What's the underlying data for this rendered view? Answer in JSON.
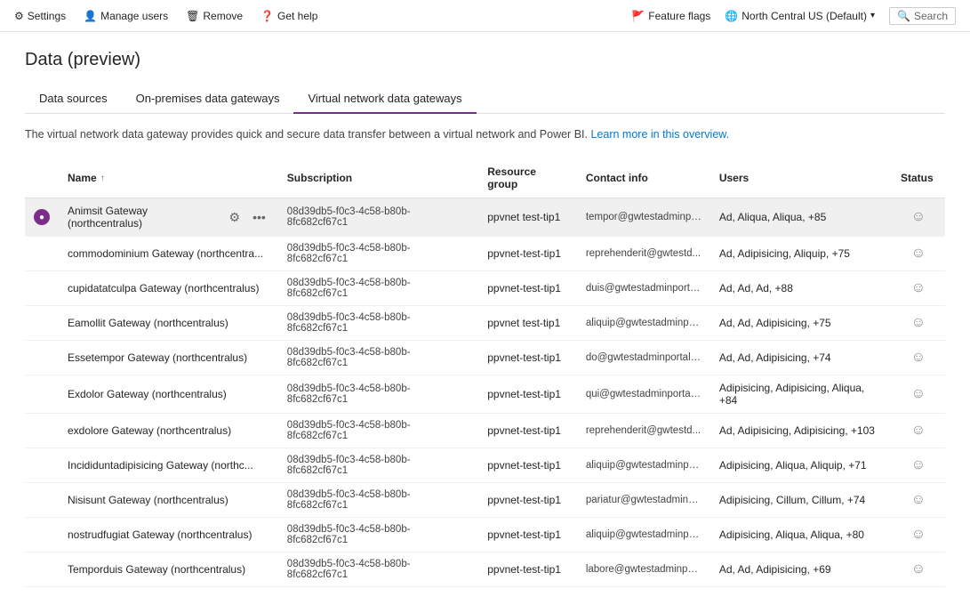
{
  "topbar": {
    "items_left": [
      {
        "id": "settings",
        "icon": "⚙",
        "label": "Settings"
      },
      {
        "id": "manage-users",
        "icon": "👤",
        "label": "Manage users"
      },
      {
        "id": "remove",
        "icon": "🗑",
        "label": "Remove"
      },
      {
        "id": "get-help",
        "icon": "❓",
        "label": "Get help"
      }
    ],
    "items_right": [
      {
        "id": "feature-flags",
        "icon": "🚩",
        "label": "Feature flags"
      },
      {
        "id": "region",
        "icon": "🌐",
        "label": "North Central US (Default)"
      },
      {
        "id": "search",
        "icon": "🔍",
        "label": "Search"
      }
    ]
  },
  "page": {
    "title": "Data (preview)"
  },
  "tabs": [
    {
      "id": "data-sources",
      "label": "Data sources",
      "active": false
    },
    {
      "id": "on-premises",
      "label": "On-premises data gateways",
      "active": false
    },
    {
      "id": "virtual-network",
      "label": "Virtual network data gateways",
      "active": true
    }
  ],
  "description": {
    "text": "The virtual network data gateway provides quick and secure data transfer between a virtual network and Power BI.",
    "link_text": "Learn more in this overview.",
    "link_url": "#"
  },
  "table": {
    "columns": [
      {
        "id": "name",
        "label": "Name",
        "sort": "↑"
      },
      {
        "id": "subscription",
        "label": "Subscription"
      },
      {
        "id": "resource-group",
        "label": "Resource group"
      },
      {
        "id": "contact-info",
        "label": "Contact info"
      },
      {
        "id": "users",
        "label": "Users"
      },
      {
        "id": "status",
        "label": "Status"
      }
    ],
    "rows": [
      {
        "id": "row-1",
        "selected": true,
        "icon": "●",
        "name": "Animsit Gateway (northcentralus)",
        "subscription": "08d39db5-f0c3-4c58-b80b-8fc682cf67c1",
        "resource_group": "ppvnet test-tip1",
        "contact_info": "tempor@gwtestadminport...",
        "users": "Ad, Aliqua, Aliqua, +85",
        "status": "😊"
      },
      {
        "id": "row-2",
        "selected": false,
        "icon": "",
        "name": "commodominium Gateway (northcentra...",
        "subscription": "08d39db5-f0c3-4c58-b80b-8fc682cf67c1",
        "resource_group": "ppvnet-test-tip1",
        "contact_info": "reprehenderit@gwtestd...",
        "users": "Ad, Adipisicing, Aliquip, +75",
        "status": "😊"
      },
      {
        "id": "row-3",
        "selected": false,
        "icon": "",
        "name": "cupidatatculpa Gateway (northcentralus)",
        "subscription": "08d39db5-f0c3-4c58-b80b-8fc682cf67c1",
        "resource_group": "ppvnet-test-tip1",
        "contact_info": "duis@gwtestadminportal...",
        "users": "Ad, Ad, Ad, +88",
        "status": "😊"
      },
      {
        "id": "row-4",
        "selected": false,
        "icon": "",
        "name": "Eamollit Gateway (northcentralus)",
        "subscription": "08d39db5-f0c3-4c58-b80b-8fc682cf67c1",
        "resource_group": "ppvnet test-tip1",
        "contact_info": "aliquip@gwtestadminport...",
        "users": "Ad, Ad, Adipisicing, +75",
        "status": "😊"
      },
      {
        "id": "row-5",
        "selected": false,
        "icon": "",
        "name": "Essetempor Gateway (northcentralus)",
        "subscription": "08d39db5-f0c3-4c58-b80b-8fc682cf67c1",
        "resource_group": "ppvnet-test-tip1",
        "contact_info": "do@gwtestadminportal c...",
        "users": "Ad, Ad, Adipisicing, +74",
        "status": "😊"
      },
      {
        "id": "row-6",
        "selected": false,
        "icon": "",
        "name": "Exdolor Gateway (northcentralus)",
        "subscription": "08d39db5-f0c3-4c58-b80b-8fc682cf67c1",
        "resource_group": "ppvnet-test-tip1",
        "contact_info": "qui@gwtestadminportal.c...",
        "users": "Adipisicing, Adipisicing, Aliqua, +84",
        "status": "😊"
      },
      {
        "id": "row-7",
        "selected": false,
        "icon": "",
        "name": "exdolore Gateway (northcentralus)",
        "subscription": "08d39db5-f0c3-4c58-b80b-8fc682cf67c1",
        "resource_group": "ppvnet-test-tip1",
        "contact_info": "reprehenderit@gwtestd...",
        "users": "Ad, Adipisicing, Adipisicing, +103",
        "status": "😊"
      },
      {
        "id": "row-8",
        "selected": false,
        "icon": "",
        "name": "Incididuntadipisicing Gateway (northc...",
        "subscription": "08d39db5-f0c3-4c58-b80b-8fc682cf67c1",
        "resource_group": "ppvnet-test-tip1",
        "contact_info": "aliquip@gwtestadminport...",
        "users": "Adipisicing, Aliqua, Aliquip, +71",
        "status": "😊"
      },
      {
        "id": "row-9",
        "selected": false,
        "icon": "",
        "name": "Nisisunt Gateway (northcentralus)",
        "subscription": "08d39db5-f0c3-4c58-b80b-8fc682cf67c1",
        "resource_group": "ppvnet-test-tip1",
        "contact_info": "pariatur@gwtestadminpor...",
        "users": "Adipisicing, Cillum, Cillum, +74",
        "status": "😊"
      },
      {
        "id": "row-10",
        "selected": false,
        "icon": "",
        "name": "nostrudfugiat Gateway (northcentralus)",
        "subscription": "08d39db5-f0c3-4c58-b80b-8fc682cf67c1",
        "resource_group": "ppvnet-test-tip1",
        "contact_info": "aliquip@gwtestadminport...",
        "users": "Adipisicing, Aliqua, Aliqua, +80",
        "status": "😊"
      },
      {
        "id": "row-11",
        "selected": false,
        "icon": "",
        "name": "Temporduis Gateway (northcentralus)",
        "subscription": "08d39db5-f0c3-4c58-b80b-8fc682cf67c1",
        "resource_group": "ppvnet-test-tip1",
        "contact_info": "labore@gwtestadminport...",
        "users": "Ad, Ad, Adipisicing, +69",
        "status": "😊"
      }
    ]
  }
}
